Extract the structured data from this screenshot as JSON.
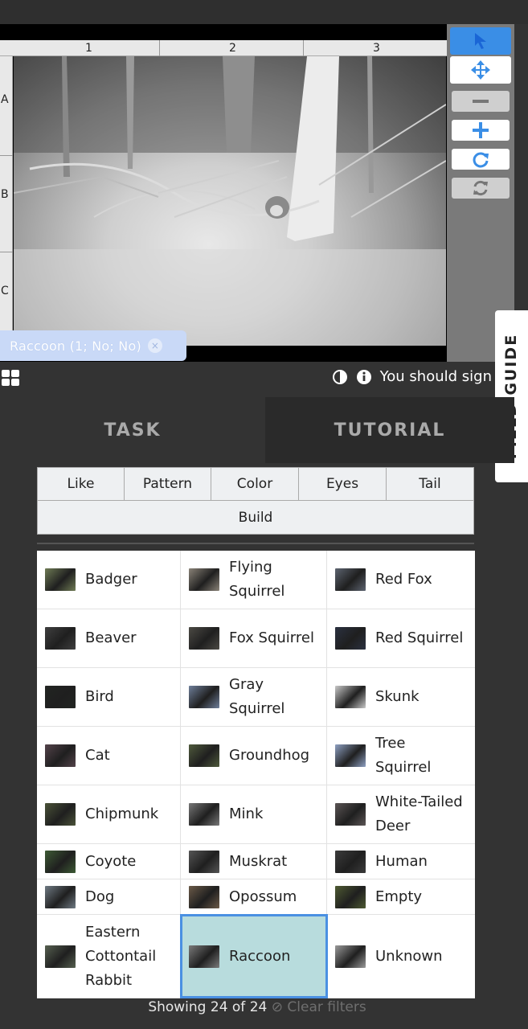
{
  "viewer": {
    "columns": [
      "1",
      "2",
      "3"
    ],
    "rows": [
      "A",
      "B",
      "C"
    ]
  },
  "annotation": {
    "label": "Raccoon (1; No; No)",
    "remove": "×"
  },
  "status": {
    "message": "You should sign"
  },
  "field_guide": "FIELD GUIDE",
  "tabs": {
    "task": "TASK",
    "tutorial": "TUTORIAL"
  },
  "filters": [
    "Like",
    "Pattern",
    "Color",
    "Eyes",
    "Tail"
  ],
  "build_label": "Build",
  "species": [
    [
      {
        "name": "Badger",
        "thumb": "#6f7b55"
      },
      {
        "name": "Flying Squirrel",
        "thumb": "#8a8378"
      },
      {
        "name": "Red Fox",
        "thumb": "#5d6470"
      }
    ],
    [
      {
        "name": "Beaver",
        "thumb": "#3f3f3f"
      },
      {
        "name": "Fox Squirrel",
        "thumb": "#4c4a44"
      },
      {
        "name": "Red Squirrel",
        "thumb": "#2b3140"
      }
    ],
    [
      {
        "name": "Bird",
        "thumb": "#222522"
      },
      {
        "name": "Gray Squirrel",
        "thumb": "#6f7f9a"
      },
      {
        "name": "Skunk",
        "thumb": "#c9c9c9"
      }
    ],
    [
      {
        "name": "Cat",
        "thumb": "#53434a"
      },
      {
        "name": "Groundhog",
        "thumb": "#4f5a3c"
      },
      {
        "name": "Tree Squirrel",
        "thumb": "#8ea0c2"
      }
    ],
    [
      {
        "name": "Chipmunk",
        "thumb": "#4a5238"
      },
      {
        "name": "Mink",
        "thumb": "#777777"
      },
      {
        "name": "White-Tailed Deer",
        "thumb": "#5b5555"
      }
    ],
    [
      {
        "name": "Coyote",
        "thumb": "#3d5a34"
      },
      {
        "name": "Muskrat",
        "thumb": "#555555"
      },
      {
        "name": "Human",
        "thumb": "#3b3b3b"
      }
    ],
    [
      {
        "name": "Dog",
        "thumb": "#6f7a83"
      },
      {
        "name": "Opossum",
        "thumb": "#6b5a48"
      },
      {
        "name": "Empty",
        "thumb": "#4e5a32"
      }
    ],
    [
      {
        "name": "Eastern Cottontail Rabbit",
        "thumb": "#566050"
      },
      {
        "name": "Raccoon",
        "thumb": "#7a7a7a"
      },
      {
        "name": "Unknown",
        "thumb": "#9a9a9a"
      }
    ]
  ],
  "selected_species": "Raccoon",
  "footer": {
    "showing": "Showing 24 of 24",
    "clear": "Clear filters"
  },
  "colors": {
    "accent": "#3a8ee6",
    "selected": "#b8dcdd",
    "chip": "#c9d9f7"
  }
}
